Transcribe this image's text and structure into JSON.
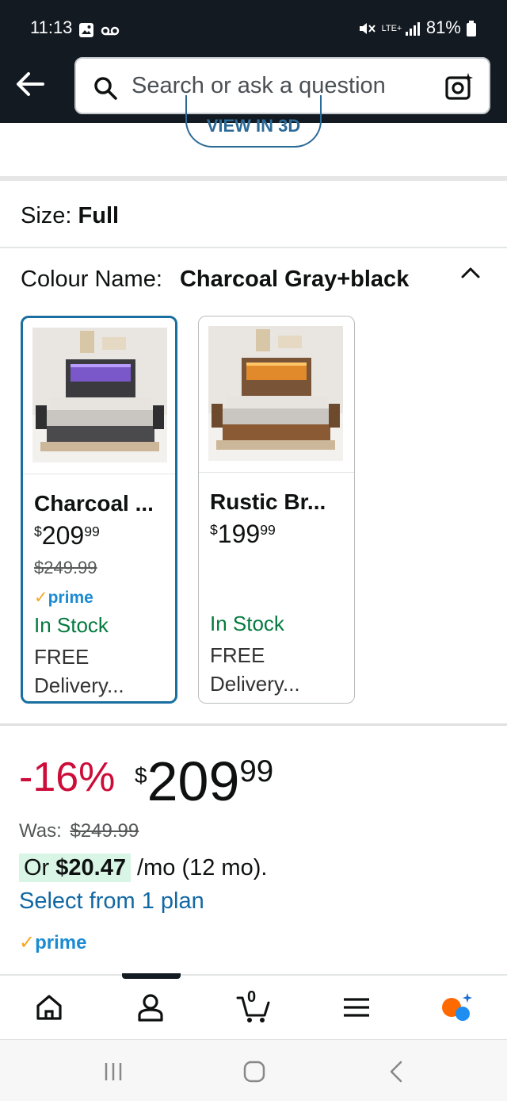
{
  "status_bar": {
    "time": "11:13",
    "network": "LTE+",
    "battery": "81%"
  },
  "header": {
    "search_placeholder": "Search or ask a question"
  },
  "view3d_label": "VIEW IN 3D",
  "size": {
    "label": "Size:",
    "value": "Full"
  },
  "colour": {
    "label": "Colour Name:",
    "value": "Charcoal Gray+black"
  },
  "variants": [
    {
      "name": "Charcoal ...",
      "price_whole": "209",
      "price_frac": "99",
      "currency": "$",
      "was": "$249.99",
      "prime": "prime",
      "stock": "In Stock",
      "free": "FREE",
      "delivery": "Delivery..."
    },
    {
      "name": "Rustic Br...",
      "price_whole": "199",
      "price_frac": "99",
      "currency": "$",
      "was": "",
      "prime": "",
      "stock": "In Stock",
      "free": "FREE",
      "delivery": "Delivery..."
    }
  ],
  "pricing": {
    "discount": "-16%",
    "currency": "$",
    "price_whole": "209",
    "price_frac": "99",
    "was_label": "Was:",
    "was_value": "$249.99",
    "monthly_prefix": "Or",
    "monthly_amount": "$20.47",
    "monthly_suffix": "/mo (12 mo).",
    "plan_link": "Select from 1 plan",
    "prime": "prime"
  },
  "bottom_nav": {
    "cart_count": "0"
  },
  "colors": {
    "header_bg": "#131a22",
    "link": "#1268a3",
    "discount": "#cc0c39",
    "in_stock": "#047a3f",
    "selected_border": "#1a6fa0"
  }
}
